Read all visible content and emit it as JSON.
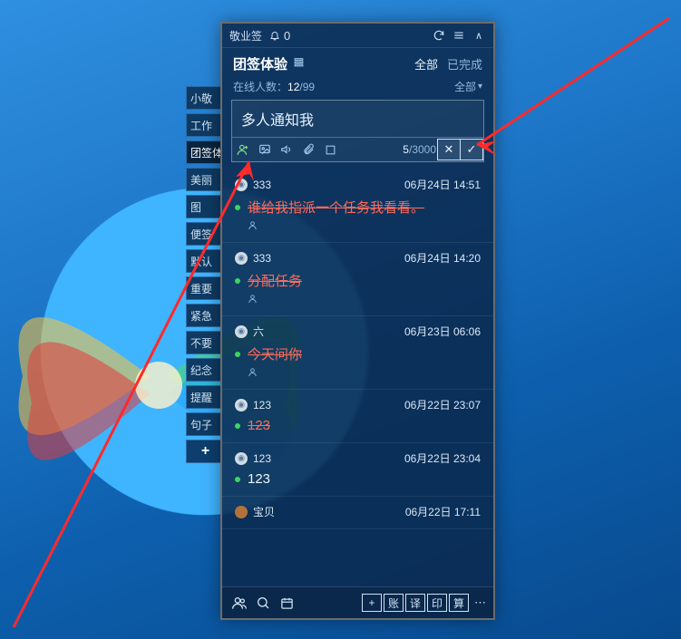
{
  "titlebar": {
    "app": "敬业签",
    "badge": "0"
  },
  "header": {
    "team": "团签体验",
    "tab_all": "全部",
    "tab_done": "已完成"
  },
  "online": {
    "label": "在线人数：",
    "current": "12",
    "max": "/99",
    "filter": "全部"
  },
  "input": {
    "text": "多人通知我",
    "count": "5",
    "max": "/3000"
  },
  "items": [
    {
      "user": "333",
      "time": "06月24日 14:51",
      "content": "谁给我指派一个任务我看看。",
      "strike": true,
      "sub": true
    },
    {
      "user": "333",
      "time": "06月24日 14:20",
      "content": "分配任务",
      "strike": true,
      "sub": true
    },
    {
      "user": "六",
      "time": "06月23日 06:06",
      "content": "今天问你",
      "strike": true,
      "sub": true
    },
    {
      "user": "123",
      "time": "06月22日 23:07",
      "content": "123",
      "strike": true,
      "sub": false
    },
    {
      "user": "123",
      "time": "06月22日 23:04",
      "content": "123",
      "strike": false,
      "white": true,
      "sub": false
    },
    {
      "user": "宝贝",
      "time": "06月22日 17:11",
      "content": "",
      "avatar_img": true
    }
  ],
  "footer": {
    "b1": "账",
    "b2": "译",
    "b3": "印",
    "b4": "算"
  },
  "sidetabs": [
    "小敬",
    "工作",
    "团签体验",
    "美丽",
    "图",
    "便签",
    "默认",
    "重要",
    "紧急",
    "不要",
    "纪念",
    "提醒",
    "句子"
  ]
}
